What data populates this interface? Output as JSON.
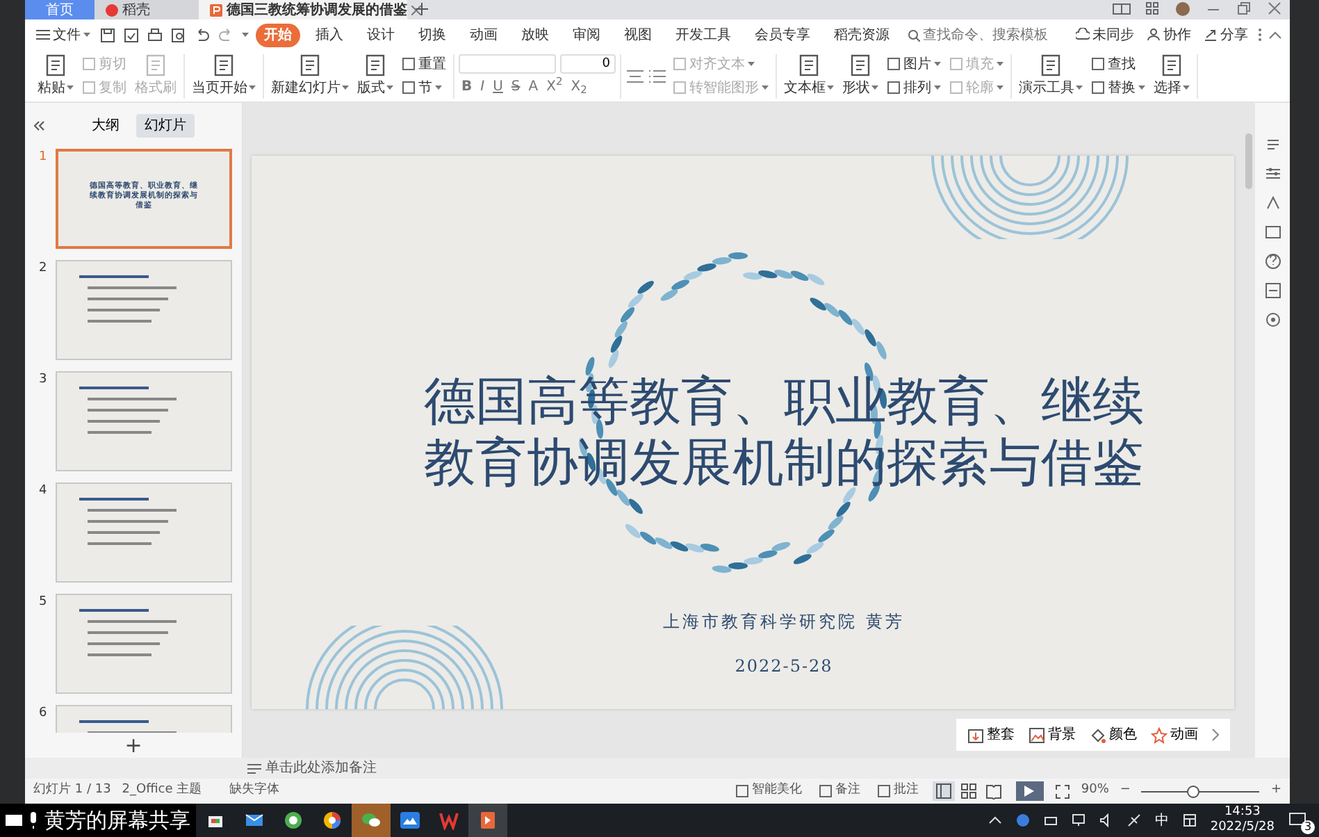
{
  "title_tabs": [
    {
      "label": "首页",
      "selected": false,
      "kind": "home"
    },
    {
      "label": "稻壳",
      "selected": false,
      "kind": "app"
    },
    {
      "label": "德国三教统筹协调发展的借鉴",
      "selected": true,
      "kind": "doc"
    }
  ],
  "menu": {
    "file": "文件",
    "items": [
      {
        "label": "开始",
        "selected": true
      },
      {
        "label": "插入",
        "selected": false
      },
      {
        "label": "设计",
        "selected": false
      },
      {
        "label": "切换",
        "selected": false
      },
      {
        "label": "动画",
        "selected": false
      },
      {
        "label": "放映",
        "selected": false
      },
      {
        "label": "审阅",
        "selected": false
      },
      {
        "label": "视图",
        "selected": false
      },
      {
        "label": "开发工具",
        "selected": false
      },
      {
        "label": "会员专享",
        "selected": false
      },
      {
        "label": "稻壳资源",
        "selected": false
      }
    ],
    "search": {
      "placeholder": "查找命令、搜索模板"
    },
    "actions": [
      "未同步",
      "协作",
      "分享"
    ]
  },
  "ribbon": [
    [
      {
        "kind": "big",
        "label": "粘贴",
        "disabled": false,
        "dropdown": true
      },
      {
        "kind": "stack",
        "items": [
          {
            "label": "剪切",
            "disabled": true,
            "dropdown": false
          },
          {
            "label": "复制",
            "disabled": true,
            "dropdown": false
          }
        ]
      },
      {
        "kind": "big",
        "label": "格式刷",
        "disabled": true,
        "dropdown": false
      }
    ],
    [
      {
        "kind": "big",
        "label": "当页开始",
        "disabled": false,
        "dropdown": true
      }
    ],
    [
      {
        "kind": "big",
        "label": "新建幻灯片",
        "disabled": false,
        "dropdown": true
      },
      {
        "kind": "big",
        "label": "版式",
        "disabled": false,
        "dropdown": true
      },
      {
        "kind": "stack",
        "items": [
          {
            "label": "重置",
            "disabled": false,
            "dropdown": false
          },
          {
            "label": "节",
            "disabled": false,
            "dropdown": true
          }
        ]
      }
    ],
    [
      {
        "kind": "font",
        "size": "0",
        "formats": [
          "B",
          "I",
          "U",
          "S",
          "A",
          "X$^{2}$",
          "X$_{2}$"
        ]
      }
    ],
    [
      {
        "kind": "stack",
        "items": [
          {
            "label": "对齐文本",
            "disabled": true,
            "dropdown": true
          },
          {
            "label": "转智能图形",
            "disabled": true,
            "dropdown": true
          }
        ]
      }
    ],
    [
      {
        "kind": "big",
        "label": "文本框",
        "disabled": false,
        "dropdown": true
      },
      {
        "kind": "big",
        "label": "形状",
        "disabled": false,
        "dropdown": true
      },
      {
        "kind": "stack",
        "items": [
          {
            "label": "图片",
            "disabled": false,
            "dropdown": true
          },
          {
            "label": "排列",
            "disabled": false,
            "dropdown": true
          }
        ]
      },
      {
        "kind": "stack",
        "items": [
          {
            "label": "填充",
            "disabled": true,
            "dropdown": true
          },
          {
            "label": "轮廓",
            "disabled": true,
            "dropdown": true
          }
        ]
      }
    ],
    [
      {
        "kind": "big",
        "label": "演示工具",
        "disabled": false,
        "dropdown": true
      },
      {
        "kind": "stack",
        "items": [
          {
            "label": "查找",
            "disabled": false,
            "dropdown": false
          },
          {
            "label": "替换",
            "disabled": false,
            "dropdown": true
          }
        ]
      },
      {
        "kind": "big",
        "label": "选择",
        "disabled": false,
        "dropdown": true
      }
    ]
  ],
  "panel": {
    "tabs": [
      {
        "label": "大纲",
        "selected": false
      },
      {
        "label": "幻灯片",
        "selected": true
      }
    ],
    "slides": [
      {
        "number": "1",
        "selected": true,
        "title": "德国高等教育、职业教育、继续教育协调发展机制的探索与借鉴"
      },
      {
        "number": "2",
        "selected": false
      },
      {
        "number": "3",
        "selected": false
      },
      {
        "number": "4",
        "selected": false
      },
      {
        "number": "5",
        "selected": false
      },
      {
        "number": "6",
        "selected": false
      }
    ],
    "add": "+"
  },
  "slide": {
    "title": "德国高等教育、职业教育、继续教育协调发展机制的探索与借鉴",
    "author": "上海市教育科学研究院  黄芳",
    "date": "2022-5-28"
  },
  "float_toolbar": [
    "整套",
    "背景",
    "颜色",
    "动画"
  ],
  "notes": {
    "placeholder": "单击此处添加备注"
  },
  "status": {
    "left": [
      "幻灯片 1 / 13",
      "2_Office 主题",
      "缺失字体"
    ],
    "right": [
      "智能美化",
      "备注",
      "批注"
    ],
    "views": [
      {
        "selected": true
      },
      {
        "selected": false
      },
      {
        "selected": false
      }
    ],
    "zoom": "90%",
    "zoom_slider": {
      "level": 0.44
    },
    "minus": "−",
    "plus": "+"
  },
  "taskbar": {
    "share": "黄芳的屏幕共享",
    "ime": "中",
    "time": "14:53",
    "date": "2022/5/28",
    "notifications": "3"
  }
}
